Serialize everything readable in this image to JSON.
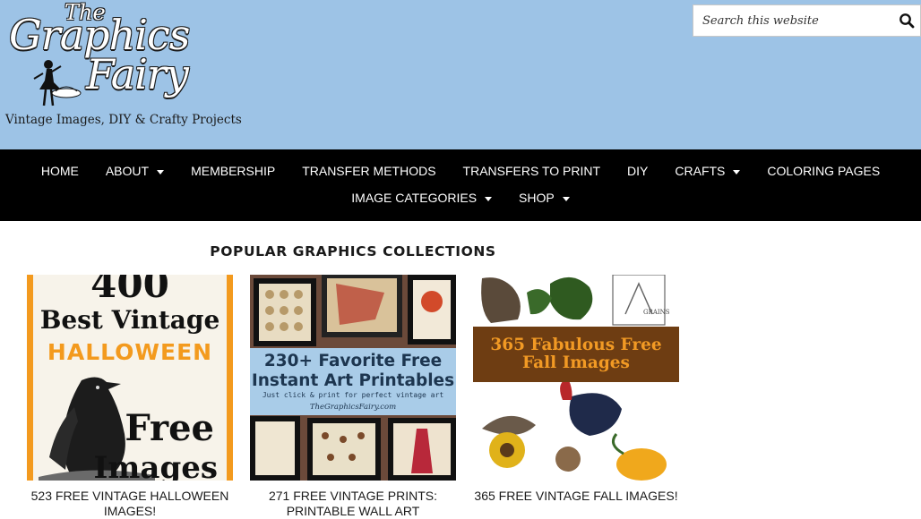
{
  "site": {
    "logo_the": "The",
    "logo_graphics": "Graphics",
    "logo_fairy": "Fairy",
    "tagline": "Vintage Images, DIY & Crafty Projects"
  },
  "search": {
    "placeholder": "Search this website",
    "icon": "search-icon"
  },
  "nav": {
    "row1": [
      {
        "label": "HOME",
        "dropdown": false
      },
      {
        "label": "ABOUT",
        "dropdown": true
      },
      {
        "label": "MEMBERSHIP",
        "dropdown": false
      },
      {
        "label": "TRANSFER METHODS",
        "dropdown": false
      },
      {
        "label": "TRANSFERS TO PRINT",
        "dropdown": false
      },
      {
        "label": "DIY",
        "dropdown": false
      },
      {
        "label": "CRAFTS",
        "dropdown": true
      },
      {
        "label": "COLORING PAGES",
        "dropdown": false
      }
    ],
    "row2": [
      {
        "label": "IMAGE CATEGORIES",
        "dropdown": true
      },
      {
        "label": "SHOP",
        "dropdown": true
      }
    ]
  },
  "section": {
    "title": "POPULAR GRAPHICS COLLECTIONS"
  },
  "cards": [
    {
      "caption": "523 FREE VINTAGE HALLOWEEN IMAGES!",
      "thumb": {
        "big": "400",
        "line1": "Best Vintage",
        "line2": "HALLOWEEN",
        "line3": "Free",
        "line4": "Images"
      }
    },
    {
      "caption": "271 FREE VINTAGE PRINTS: PRINTABLE WALL ART",
      "thumb": {
        "line1": "230+ Favorite Free",
        "line2": "Instant Art Printables",
        "line3": "Just click & print for perfect vintage art",
        "line4": "TheGraphicsFairy.com"
      }
    },
    {
      "caption": "365 FREE VINTAGE FALL IMAGES!",
      "thumb": {
        "line1": "365 Fabulous Free",
        "line2": "Fall Images",
        "label": "GRAINS"
      }
    }
  ],
  "colors": {
    "header_bg": "#9dc3e6",
    "nav_bg": "#000000",
    "halloween_accent": "#f39a1e",
    "fall_band": "#6e3d12"
  }
}
